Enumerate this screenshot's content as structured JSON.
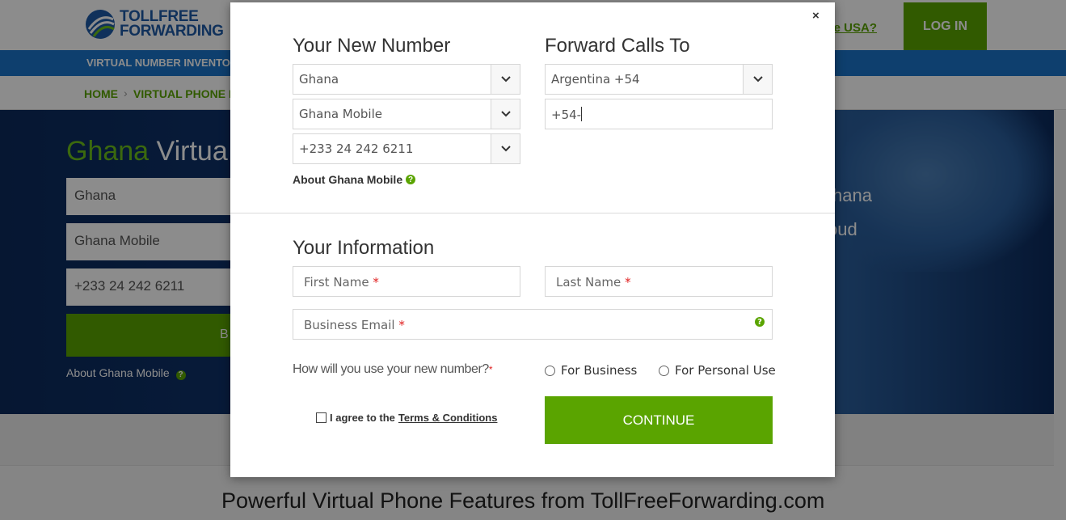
{
  "header": {
    "logo_line1": "TOLLFREE",
    "logo_line2": "FORWARDING",
    "outside_link": "side USA?",
    "login_label": "LOG IN"
  },
  "nav": {
    "label": "VIRTUAL NUMBER INVENTO"
  },
  "breadcrumb": {
    "home": "HOME",
    "sep": "›",
    "current": "VIRTUAL PHONE N"
  },
  "hero": {
    "title_green": "Ghana",
    "title_rest": " Virtua",
    "field_country": "Ghana",
    "field_type": "Ghana Mobile",
    "field_number": "+233 24 242 6211",
    "button_partial": "B",
    "about": "About Ghana Mobile",
    "right_text_1": "hana",
    "right_text_2": "oud"
  },
  "features_title": "Powerful Virtual Phone Features from TollFreeForwarding.com",
  "modal": {
    "close": "×",
    "new_number": {
      "title": "Your New Number",
      "country": "Ghana",
      "number_type": "Ghana Mobile",
      "number": "+233 24 242 6211",
      "about": "About Ghana Mobile"
    },
    "forward": {
      "title": "Forward Calls To",
      "country": "Argentina +54",
      "phone_value": "+54-"
    },
    "info": {
      "title": "Your Information",
      "first_name_placeholder": "First Name",
      "last_name_placeholder": "Last Name",
      "email_placeholder": "Business Email",
      "required_mark": "*",
      "usage_question": "How will you use your new number?",
      "option_business": "For Business",
      "option_personal": "For Personal Use",
      "agree_text": "I agree to the",
      "terms_link": "Terms & Conditions",
      "continue_label": "CONTINUE"
    }
  },
  "colors": {
    "brand_green": "#5aa400",
    "brand_blue": "#1a73c8",
    "required_red": "#e02020"
  },
  "icons": [
    "logo-swoosh-icon",
    "chevron-down-icon",
    "help-circle-icon",
    "close-icon"
  ]
}
